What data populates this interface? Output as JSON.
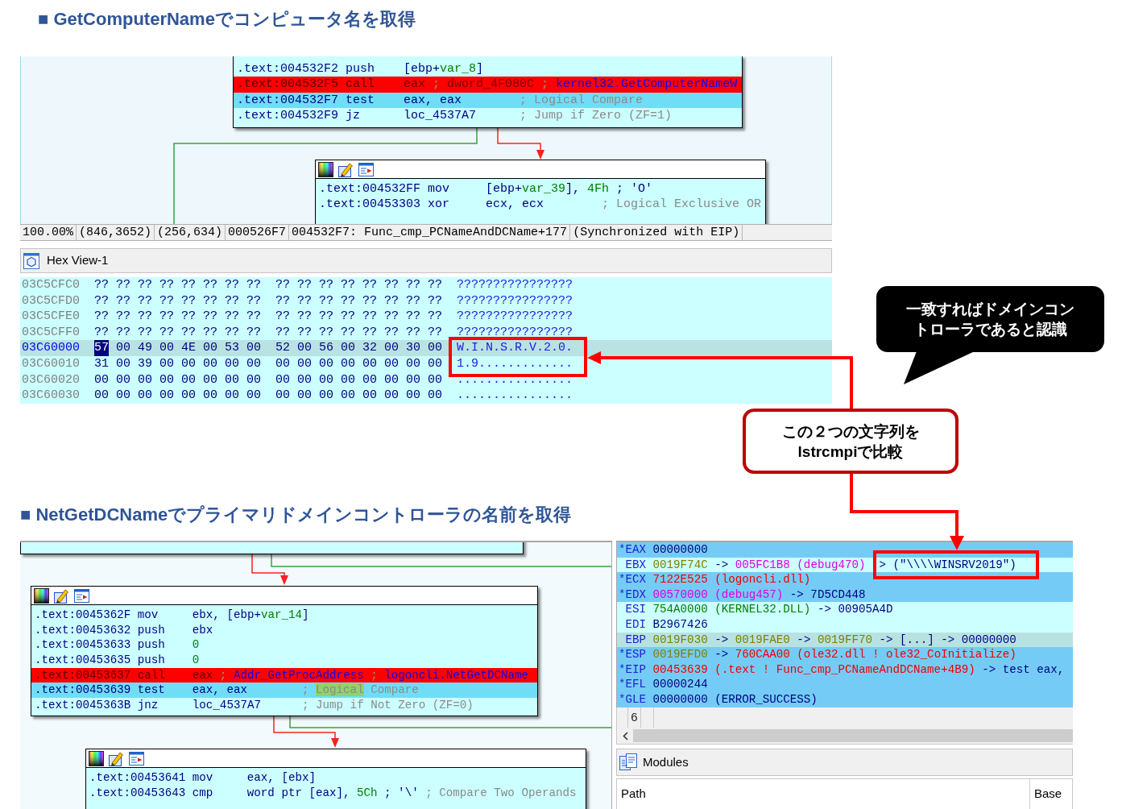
{
  "section_1": {
    "heading": "■ GetComputerNameでコンピュータ名を取得",
    "graph_nodes": [
      {
        "toolbar": false,
        "lines": [
          {
            "kind": "normal",
            "address": ".text:004532F2",
            "mnemonic": "push",
            "operands": [
              {
                "text": "[ebp+",
                "kind": "plain"
              },
              {
                "text": "var_8",
                "kind": "name"
              },
              {
                "text": "]",
                "kind": "plain"
              }
            ]
          },
          {
            "kind": "breakpoint",
            "address": ".text:004532F5",
            "mnemonic": "call",
            "operands": [
              {
                "text": "eax",
                "kind": "plain"
              },
              {
                "text": " ; ",
                "kind": "sep"
              },
              {
                "text": "dword_4F080C",
                "kind": "symbol"
              },
              {
                "text": " ; ",
                "kind": "sep"
              },
              {
                "text": "kernel32.GetComputerNameW",
                "kind": "api"
              }
            ]
          },
          {
            "kind": "current",
            "address": ".text:004532F7",
            "mnemonic": "test",
            "operands": [
              {
                "text": "eax, eax",
                "kind": "plain"
              }
            ],
            "comment": [
              {
                "text": "; Logical Compare",
                "kind": "comment"
              }
            ]
          },
          {
            "kind": "normal",
            "address": ".text:004532F9",
            "mnemonic": "jz",
            "operands": [
              {
                "text": "loc_4537A7",
                "kind": "plain"
              }
            ],
            "comment": [
              {
                "text": "; Jump if Zero (ZF=1)",
                "kind": "comment"
              }
            ]
          }
        ]
      },
      {
        "toolbar": true,
        "lines": [
          {
            "kind": "normal",
            "address": ".text:004532FF",
            "mnemonic": "mov",
            "operands": [
              {
                "text": "[ebp+",
                "kind": "plain"
              },
              {
                "text": "var_39",
                "kind": "name"
              },
              {
                "text": "], ",
                "kind": "plain"
              },
              {
                "text": "4Fh",
                "kind": "number"
              }
            ],
            "comment": [
              {
                "text": "; 'O'",
                "kind": "plain"
              }
            ]
          },
          {
            "kind": "normal",
            "address": ".text:00453303",
            "mnemonic": "xor",
            "operands": [
              {
                "text": "ecx, ecx",
                "kind": "plain"
              }
            ],
            "comment": [
              {
                "text": "; Logical Exclusive OR",
                "kind": "comment"
              }
            ]
          }
        ]
      }
    ],
    "status_bar": [
      "100.00%",
      "(846,3652)",
      "(256,634)",
      "000526F7",
      "004532F7: Func_cmp_PCNameAndDCName+177",
      "(Synchronized with EIP)"
    ],
    "hex_view": {
      "title": "Hex View-1",
      "rows": [
        {
          "address": "03C5CFC0",
          "selected": false,
          "bytes": [
            {
              "text": "??",
              "selected": false
            },
            {
              "text": "??",
              "selected": false
            },
            {
              "text": "??",
              "selected": false
            },
            {
              "text": "??",
              "selected": false
            },
            {
              "text": "??",
              "selected": false
            },
            {
              "text": "??",
              "selected": false
            },
            {
              "text": "??",
              "selected": false
            },
            {
              "text": "??",
              "selected": false
            },
            {
              "text": "??",
              "selected": false
            },
            {
              "text": "??",
              "selected": false
            },
            {
              "text": "??",
              "selected": false
            },
            {
              "text": "??",
              "selected": false
            },
            {
              "text": "??",
              "selected": false
            },
            {
              "text": "??",
              "selected": false
            },
            {
              "text": "??",
              "selected": false
            },
            {
              "text": "??",
              "selected": false
            }
          ],
          "ascii": "????????????????"
        },
        {
          "address": "03C5CFD0",
          "selected": false,
          "bytes": [
            {
              "text": "??",
              "selected": false
            },
            {
              "text": "??",
              "selected": false
            },
            {
              "text": "??",
              "selected": false
            },
            {
              "text": "??",
              "selected": false
            },
            {
              "text": "??",
              "selected": false
            },
            {
              "text": "??",
              "selected": false
            },
            {
              "text": "??",
              "selected": false
            },
            {
              "text": "??",
              "selected": false
            },
            {
              "text": "??",
              "selected": false
            },
            {
              "text": "??",
              "selected": false
            },
            {
              "text": "??",
              "selected": false
            },
            {
              "text": "??",
              "selected": false
            },
            {
              "text": "??",
              "selected": false
            },
            {
              "text": "??",
              "selected": false
            },
            {
              "text": "??",
              "selected": false
            },
            {
              "text": "??",
              "selected": false
            }
          ],
          "ascii": "????????????????"
        },
        {
          "address": "03C5CFE0",
          "selected": false,
          "bytes": [
            {
              "text": "??",
              "selected": false
            },
            {
              "text": "??",
              "selected": false
            },
            {
              "text": "??",
              "selected": false
            },
            {
              "text": "??",
              "selected": false
            },
            {
              "text": "??",
              "selected": false
            },
            {
              "text": "??",
              "selected": false
            },
            {
              "text": "??",
              "selected": false
            },
            {
              "text": "??",
              "selected": false
            },
            {
              "text": "??",
              "selected": false
            },
            {
              "text": "??",
              "selected": false
            },
            {
              "text": "??",
              "selected": false
            },
            {
              "text": "??",
              "selected": false
            },
            {
              "text": "??",
              "selected": false
            },
            {
              "text": "??",
              "selected": false
            },
            {
              "text": "??",
              "selected": false
            },
            {
              "text": "??",
              "selected": false
            }
          ],
          "ascii": "????????????????"
        },
        {
          "address": "03C5CFF0",
          "selected": false,
          "bytes": [
            {
              "text": "??",
              "selected": false
            },
            {
              "text": "??",
              "selected": false
            },
            {
              "text": "??",
              "selected": false
            },
            {
              "text": "??",
              "selected": false
            },
            {
              "text": "??",
              "selected": false
            },
            {
              "text": "??",
              "selected": false
            },
            {
              "text": "??",
              "selected": false
            },
            {
              "text": "??",
              "selected": false
            },
            {
              "text": "??",
              "selected": false
            },
            {
              "text": "??",
              "selected": false
            },
            {
              "text": "??",
              "selected": false
            },
            {
              "text": "??",
              "selected": false
            },
            {
              "text": "??",
              "selected": false
            },
            {
              "text": "??",
              "selected": false
            },
            {
              "text": "??",
              "selected": false
            },
            {
              "text": "??",
              "selected": false
            }
          ],
          "ascii": "????????????????"
        },
        {
          "address": "03C60000",
          "selected": true,
          "bytes": [
            {
              "text": "57",
              "selected": true
            },
            {
              "text": "00",
              "selected": false
            },
            {
              "text": "49",
              "selected": false
            },
            {
              "text": "00",
              "selected": false
            },
            {
              "text": "4E",
              "selected": false
            },
            {
              "text": "00",
              "selected": false
            },
            {
              "text": "53",
              "selected": false
            },
            {
              "text": "00",
              "selected": false
            },
            {
              "text": "52",
              "selected": false
            },
            {
              "text": "00",
              "selected": false
            },
            {
              "text": "56",
              "selected": false
            },
            {
              "text": "00",
              "selected": false
            },
            {
              "text": "32",
              "selected": false
            },
            {
              "text": "00",
              "selected": false
            },
            {
              "text": "30",
              "selected": false
            },
            {
              "text": "00",
              "selected": false
            }
          ],
          "ascii": "W.I.N.S.R.V.2.0."
        },
        {
          "address": "03C60010",
          "selected": false,
          "bytes": [
            {
              "text": "31",
              "selected": false
            },
            {
              "text": "00",
              "selected": false
            },
            {
              "text": "39",
              "selected": false
            },
            {
              "text": "00",
              "selected": false
            },
            {
              "text": "00",
              "selected": false
            },
            {
              "text": "00",
              "selected": false
            },
            {
              "text": "00",
              "selected": false
            },
            {
              "text": "00",
              "selected": false
            },
            {
              "text": "00",
              "selected": false
            },
            {
              "text": "00",
              "selected": false
            },
            {
              "text": "00",
              "selected": false
            },
            {
              "text": "00",
              "selected": false
            },
            {
              "text": "00",
              "selected": false
            },
            {
              "text": "00",
              "selected": false
            },
            {
              "text": "00",
              "selected": false
            },
            {
              "text": "00",
              "selected": false
            }
          ],
          "ascii": "1.9............."
        },
        {
          "address": "03C60020",
          "selected": false,
          "bytes": [
            {
              "text": "00",
              "selected": false
            },
            {
              "text": "00",
              "selected": false
            },
            {
              "text": "00",
              "selected": false
            },
            {
              "text": "00",
              "selected": false
            },
            {
              "text": "00",
              "selected": false
            },
            {
              "text": "00",
              "selected": false
            },
            {
              "text": "00",
              "selected": false
            },
            {
              "text": "00",
              "selected": false
            },
            {
              "text": "00",
              "selected": false
            },
            {
              "text": "00",
              "selected": false
            },
            {
              "text": "00",
              "selected": false
            },
            {
              "text": "00",
              "selected": false
            },
            {
              "text": "00",
              "selected": false
            },
            {
              "text": "00",
              "selected": false
            },
            {
              "text": "00",
              "selected": false
            },
            {
              "text": "00",
              "selected": false
            }
          ],
          "ascii": "................"
        },
        {
          "address": "03C60030",
          "selected": false,
          "bytes": [
            {
              "text": "00",
              "selected": false
            },
            {
              "text": "00",
              "selected": false
            },
            {
              "text": "00",
              "selected": false
            },
            {
              "text": "00",
              "selected": false
            },
            {
              "text": "00",
              "selected": false
            },
            {
              "text": "00",
              "selected": false
            },
            {
              "text": "00",
              "selected": false
            },
            {
              "text": "00",
              "selected": false
            },
            {
              "text": "00",
              "selected": false
            },
            {
              "text": "00",
              "selected": false
            },
            {
              "text": "00",
              "selected": false
            },
            {
              "text": "00",
              "selected": false
            },
            {
              "text": "00",
              "selected": false
            },
            {
              "text": "00",
              "selected": false
            },
            {
              "text": "00",
              "selected": false
            },
            {
              "text": "00",
              "selected": false
            }
          ],
          "ascii": "................"
        }
      ]
    }
  },
  "bubble": {
    "lines": [
      "一致すればドメインコン",
      "トローラであると認識"
    ]
  },
  "callout": {
    "lines": [
      "この２つの文字列を",
      "lstrcmpiで比較"
    ]
  },
  "section_2": {
    "heading": "■ NetGetDCNameでプライマリドメインコントローラの名前を取得",
    "graph_nodes": [
      {
        "toolbar": true,
        "lines": [
          {
            "kind": "normal",
            "address": ".text:0045362F",
            "mnemonic": "mov",
            "operands": [
              {
                "text": "ebx, [ebp+",
                "kind": "plain"
              },
              {
                "text": "var_14",
                "kind": "name"
              },
              {
                "text": "]",
                "kind": "plain"
              }
            ]
          },
          {
            "kind": "normal",
            "address": ".text:00453632",
            "mnemonic": "push",
            "operands": [
              {
                "text": "ebx",
                "kind": "plain"
              }
            ]
          },
          {
            "kind": "normal",
            "address": ".text:00453633",
            "mnemonic": "push",
            "operands": [
              {
                "text": "0",
                "kind": "number"
              }
            ]
          },
          {
            "kind": "normal",
            "address": ".text:00453635",
            "mnemonic": "push",
            "operands": [
              {
                "text": "0",
                "kind": "number"
              }
            ]
          },
          {
            "kind": "breakpoint",
            "address": ".text:00453637",
            "mnemonic": "call",
            "operands": [
              {
                "text": "eax",
                "kind": "plain"
              },
              {
                "text": " ; ",
                "kind": "sep"
              },
              {
                "text": "Addr_GetProcAddress",
                "kind": "api"
              },
              {
                "text": " ; ",
                "kind": "sep"
              },
              {
                "text": "logoncli.NetGetDCName",
                "kind": "api"
              }
            ]
          },
          {
            "kind": "current",
            "address": ".text:00453639",
            "mnemonic": "test",
            "operands": [
              {
                "text": "eax, eax",
                "kind": "plain"
              }
            ],
            "comment": [
              {
                "text": "; ",
                "kind": "comment"
              },
              {
                "text": "Logical",
                "kind": "hit"
              },
              {
                "text": " Compare",
                "kind": "comment"
              }
            ]
          },
          {
            "kind": "normal",
            "address": ".text:0045363B",
            "mnemonic": "jnz",
            "operands": [
              {
                "text": "loc_4537A7",
                "kind": "plain"
              }
            ],
            "comment": [
              {
                "text": "; Jump if Not Zero (ZF=0)",
                "kind": "comment"
              }
            ]
          }
        ]
      },
      {
        "toolbar": true,
        "lines": [
          {
            "kind": "normal",
            "address": ".text:00453641",
            "mnemonic": "mov",
            "operands": [
              {
                "text": "eax, [ebx]",
                "kind": "plain"
              }
            ]
          },
          {
            "kind": "normal",
            "address": ".text:00453643",
            "mnemonic": "cmp",
            "operands": [
              {
                "text": "word ptr [eax], ",
                "kind": "plain"
              },
              {
                "text": "5Ch",
                "kind": "number"
              }
            ],
            "comment": [
              {
                "text": "; '\\'",
                "kind": "plain"
              },
              {
                "text": " ; Compare Two Operands",
                "kind": "comment"
              }
            ]
          }
        ]
      }
    ],
    "registers": [
      {
        "name": "*EAX",
        "changed": true,
        "selected": false,
        "parts": [
          {
            "text": "00000000",
            "kind": "value"
          }
        ]
      },
      {
        "name": "EBX",
        "changed": false,
        "selected": false,
        "parts": [
          {
            "text": "0019F74C",
            "kind": "pointer"
          },
          {
            "text": " -> ",
            "kind": "value"
          },
          {
            "text": "005FC1B8 (debug470)",
            "kind": "debug"
          },
          {
            "text": "  > (\"\\\\\\\\WINSRV2019\")",
            "kind": "value"
          }
        ]
      },
      {
        "name": "*ECX",
        "changed": true,
        "selected": false,
        "parts": [
          {
            "text": "7122E525 (logoncli.dll)",
            "kind": "code"
          }
        ]
      },
      {
        "name": "*EDX",
        "changed": true,
        "selected": false,
        "parts": [
          {
            "text": "00570000 (debug457)",
            "kind": "debug"
          },
          {
            "text": " -> 7D5CD448",
            "kind": "value"
          }
        ]
      },
      {
        "name": "ESI",
        "changed": false,
        "selected": false,
        "parts": [
          {
            "text": "754A0000 (KERNEL32.DLL)",
            "kind": "module"
          },
          {
            "text": " -> 00905A4D",
            "kind": "value"
          }
        ]
      },
      {
        "name": "EDI",
        "changed": false,
        "selected": false,
        "parts": [
          {
            "text": "B2967426",
            "kind": "value"
          }
        ]
      },
      {
        "name": "EBP",
        "changed": false,
        "selected": true,
        "parts": [
          {
            "text": "0019F030",
            "kind": "pointer"
          },
          {
            "text": " -> ",
            "kind": "value"
          },
          {
            "text": "0019FAE0",
            "kind": "pointer"
          },
          {
            "text": " -> ",
            "kind": "value"
          },
          {
            "text": "0019FF70",
            "kind": "pointer"
          },
          {
            "text": " -> [...] -> 00000000",
            "kind": "value"
          }
        ]
      },
      {
        "name": "*ESP",
        "changed": true,
        "selected": false,
        "parts": [
          {
            "text": "0019EFD0",
            "kind": "pointer"
          },
          {
            "text": " -> ",
            "kind": "value"
          },
          {
            "text": "760CAA00 (ole32.dll ! ole32_CoInitialize)",
            "kind": "code"
          }
        ]
      },
      {
        "name": "*EIP",
        "changed": true,
        "selected": false,
        "parts": [
          {
            "text": "00453639 (.text ! Func_cmp_PCNameAndDCName+4B9)",
            "kind": "code"
          },
          {
            "text": " -> test eax,",
            "kind": "value"
          }
        ]
      },
      {
        "name": "*EFL",
        "changed": true,
        "selected": false,
        "parts": [
          {
            "text": "00000244",
            "kind": "value"
          }
        ]
      },
      {
        "name": "*GLE",
        "changed": true,
        "selected": false,
        "parts": [
          {
            "text": "00000000 (ERROR_SUCCESS)",
            "kind": "value"
          }
        ]
      }
    ],
    "register_footer": "6",
    "modules": {
      "title": "Modules",
      "columns": [
        "Path",
        "Base"
      ]
    }
  }
}
